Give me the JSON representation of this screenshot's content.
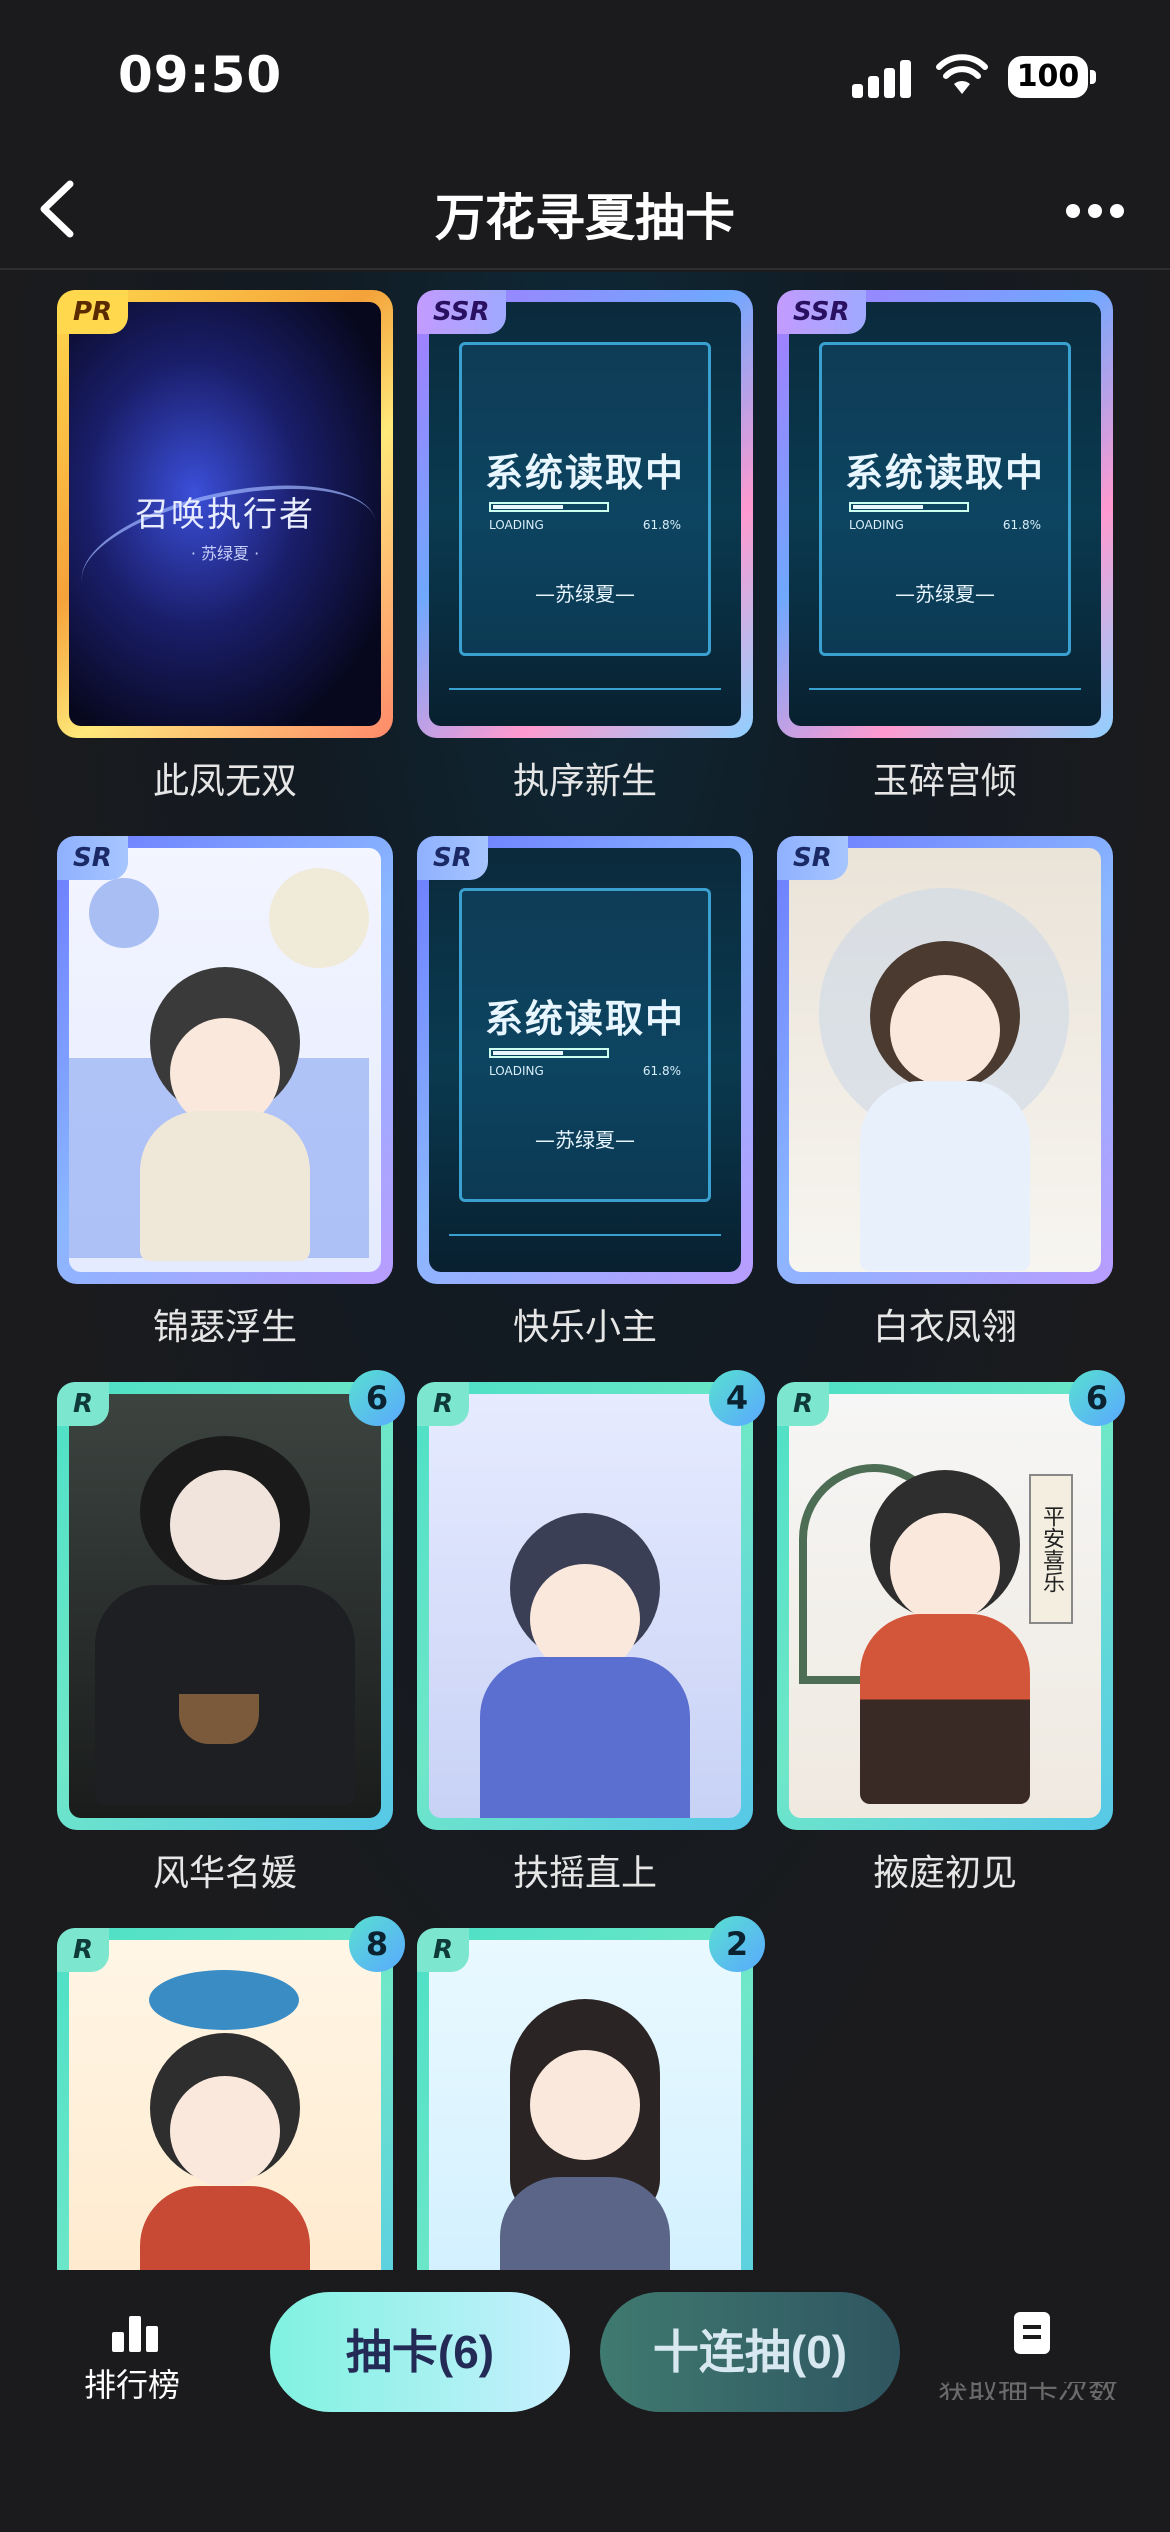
{
  "status_bar": {
    "time": "09:50",
    "battery": "100"
  },
  "nav": {
    "title": "万花寻夏抽卡"
  },
  "cards": [
    {
      "rarity": "PR",
      "name": "此凤无双",
      "count": "",
      "art_title": "召唤执行者",
      "art_subtitle": "· 苏绿夏 ·"
    },
    {
      "rarity": "SSR",
      "name": "执序新生",
      "count": "",
      "art_title": "系统读取中",
      "art_loading": "LOADING",
      "art_percent": "61.8%",
      "art_signature": "—苏绿夏—"
    },
    {
      "rarity": "SSR",
      "name": "玉碎宫倾",
      "count": "",
      "art_title": "系统读取中",
      "art_loading": "LOADING",
      "art_percent": "61.8%",
      "art_signature": "—苏绿夏—"
    },
    {
      "rarity": "SR",
      "name": "锦瑟浮生",
      "count": ""
    },
    {
      "rarity": "SR",
      "name": "快乐小主",
      "count": "",
      "art_title": "系统读取中",
      "art_loading": "LOADING",
      "art_percent": "61.8%",
      "art_signature": "—苏绿夏—"
    },
    {
      "rarity": "SR",
      "name": "白衣凤翎",
      "count": ""
    },
    {
      "rarity": "R",
      "name": "风华名媛",
      "count": "6"
    },
    {
      "rarity": "R",
      "name": "扶摇直上",
      "count": "4"
    },
    {
      "rarity": "R",
      "name": "掖庭初见",
      "count": "6",
      "art_scroll": "平安喜乐"
    },
    {
      "rarity": "R",
      "name": "",
      "count": "8"
    },
    {
      "rarity": "R",
      "name": "",
      "count": "2"
    }
  ],
  "bottom_bar": {
    "ranking_label": "排行榜",
    "draw_label": "抽卡(6)",
    "ten_draw_label": "十连抽(0)",
    "notes_label": "获取抽卡次数"
  }
}
